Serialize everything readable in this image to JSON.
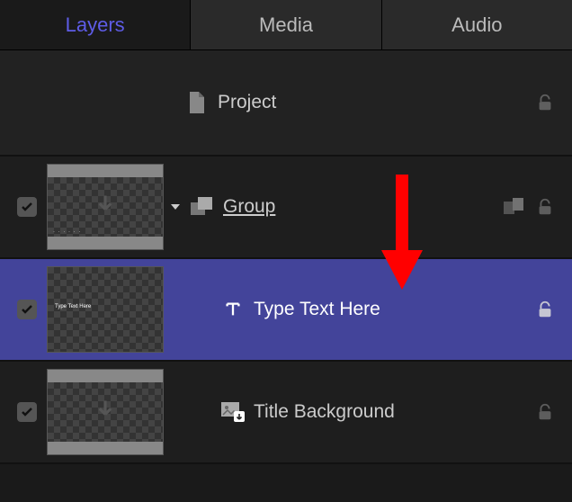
{
  "tabs": {
    "layers": "Layers",
    "media": "Media",
    "audio": "Audio",
    "active": "layers"
  },
  "rows": {
    "project": {
      "label": "Project"
    },
    "group": {
      "label": "Group",
      "checked": true,
      "expanded": true
    },
    "text": {
      "label": "Type Text Here",
      "checked": true
    },
    "titlebg": {
      "label": "Title Background",
      "checked": true
    }
  },
  "annotation": {
    "color": "#ff0000"
  }
}
